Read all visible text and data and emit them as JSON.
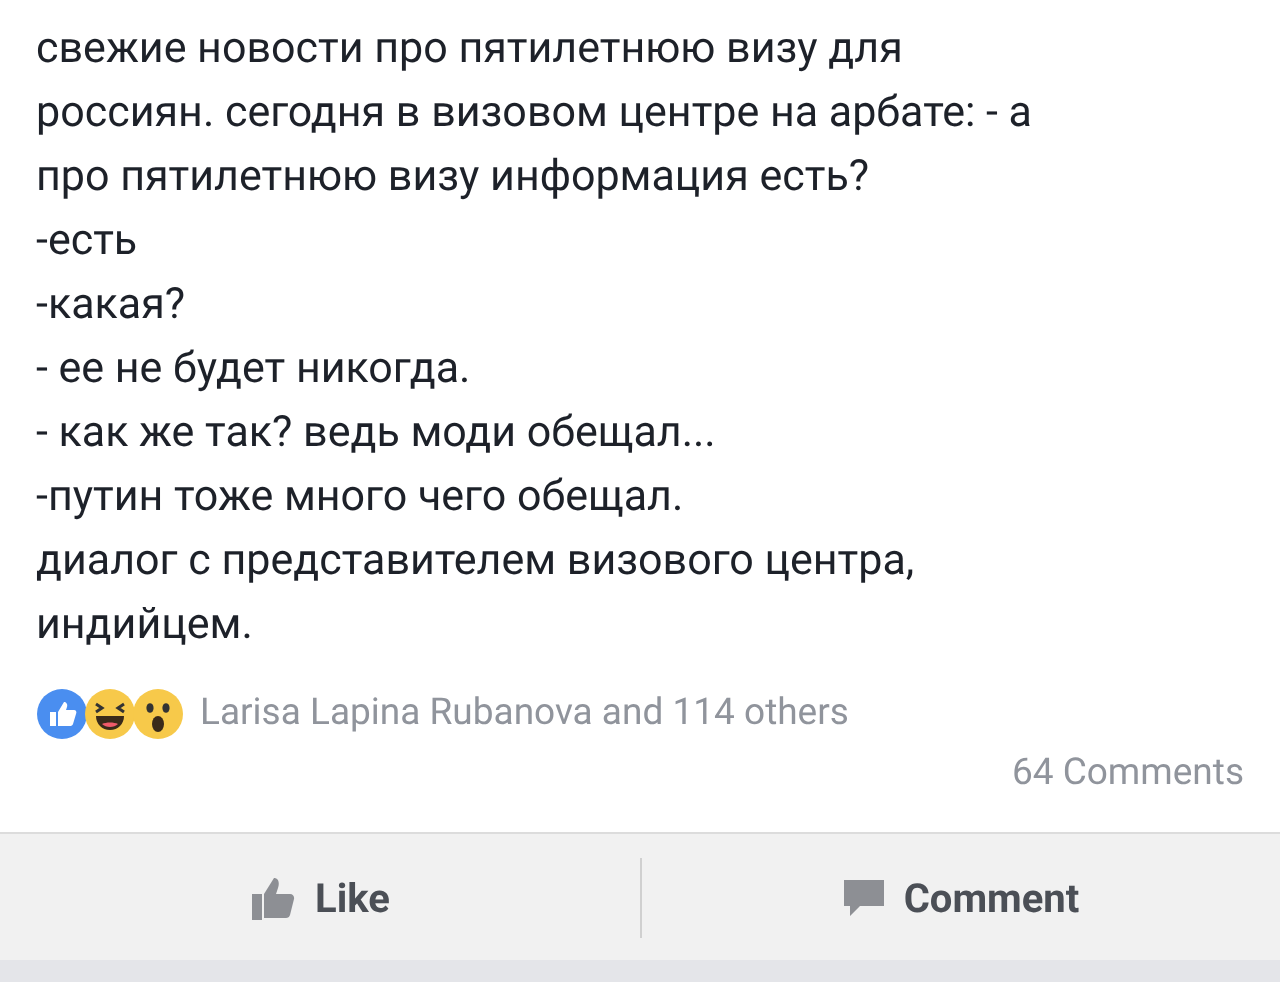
{
  "post": {
    "lines": [
      "свежие новости про пятилетнюю визу для",
      "россиян. сегодня в визовом центре на арбате: - а",
      "про пятилетнюю визу информация есть?",
      "-есть",
      "-какая?",
      "- ее не будет никогда.",
      "- как же так? ведь моди обещал...",
      "-путин тоже много чего обещал.",
      "диалог с представителем визового центра,",
      "индийцем."
    ]
  },
  "reactions": {
    "icons": [
      {
        "kind": "like"
      },
      {
        "kind": "haha"
      },
      {
        "kind": "wow"
      }
    ],
    "summary": "Larisa Lapina Rubanova and 114 others",
    "comments": "64 Comments"
  },
  "actions": [
    {
      "kind": "like",
      "label": "Like"
    },
    {
      "kind": "comment",
      "label": "Comment"
    }
  ]
}
